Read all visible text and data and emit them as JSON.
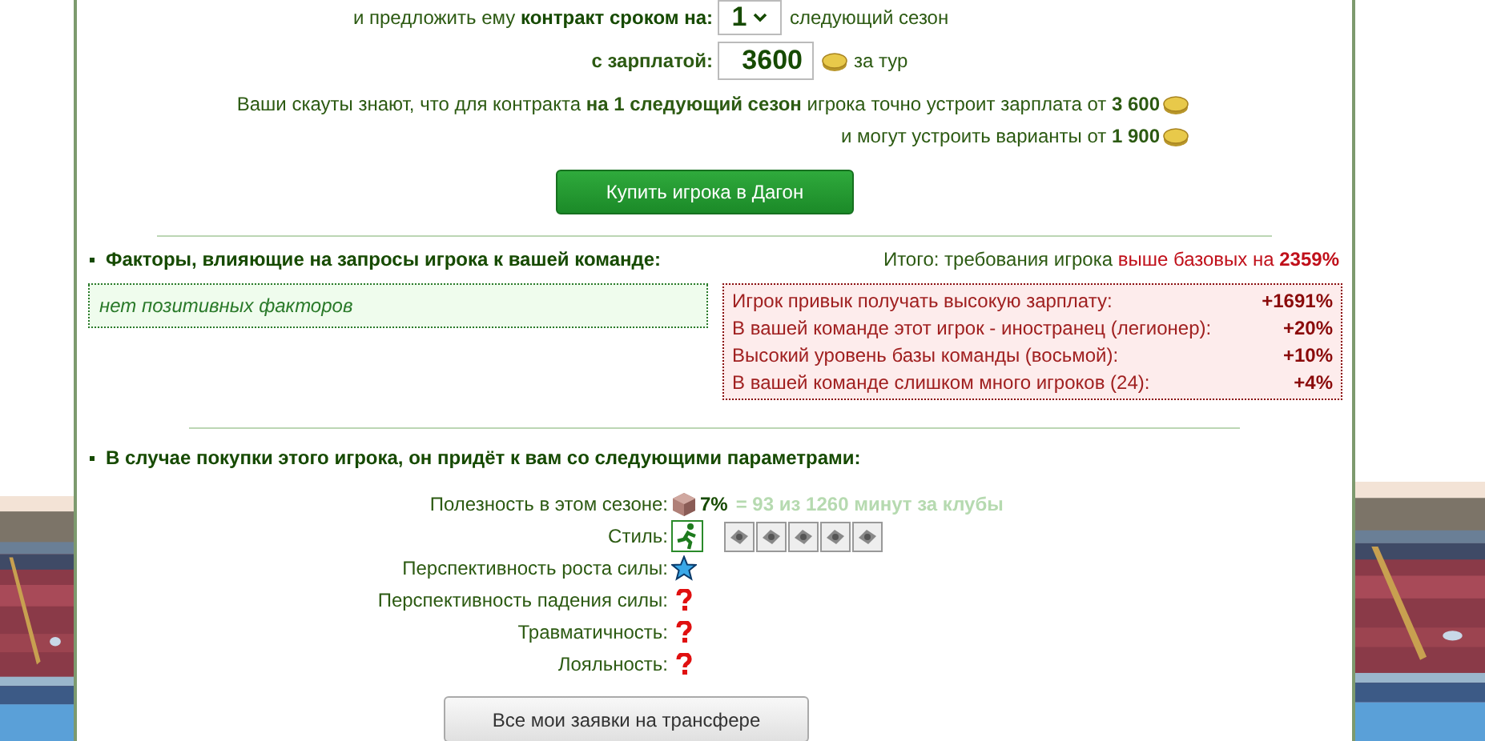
{
  "contract": {
    "prefix": "и предложить ему ",
    "prefix_bold": "контракт сроком на:",
    "term": "1",
    "term_suffix": "следующий сезон"
  },
  "salary": {
    "label": "с зарплатой:",
    "value": "3600",
    "suffix": "за тур"
  },
  "scouts": {
    "line1": "Ваши скауты знают, что для контракта **на 1 следующий сезон** игрока точно устроит зарплата от **3 600**",
    "line2": "и могут устроить варианты от **1 900**"
  },
  "buy_button": "Купить игрока в Дагон",
  "factors": {
    "title": "Факторы, влияющие на запросы игрока к вашей команде:",
    "total_prefix": "Итого: требования игрока ",
    "total_dir": "выше базовых на ",
    "total_value": "2359%",
    "positive": [
      "нет позитивных факторов"
    ],
    "negative": [
      {
        "label": "Игрок привык получать высокую зарплату:",
        "value": "+1691%"
      },
      {
        "label": "В вашей команде этот игрок - иностранец (легионер):",
        "value": "+20%"
      },
      {
        "label": "Высокий уровень базы команды (восьмой):",
        "value": "+10%"
      },
      {
        "label": "В вашей команде слишком много игроков (24):",
        "value": "+4%"
      }
    ]
  },
  "params": {
    "title": "В случае покупки этого игрока, он придёт к вам со следующими параметрами:",
    "rows": [
      {
        "kind": "usefulness",
        "label": "Полезность в этом сезоне:",
        "value": "7%",
        "detail": "= 93 из 1260 минут за клубы"
      },
      {
        "kind": "style",
        "label": "Стиль:",
        "styles": [
          {
            "selected": true
          },
          {
            "selected": false
          },
          {
            "selected": false
          },
          {
            "selected": false
          },
          {
            "selected": false
          },
          {
            "selected": false
          }
        ]
      },
      {
        "kind": "star",
        "label": "Перспективность роста силы:"
      },
      {
        "kind": "unknown",
        "label": "Перспективность падения силы:"
      },
      {
        "kind": "unknown",
        "label": "Травматичность:"
      },
      {
        "kind": "unknown",
        "label": "Лояльность:"
      }
    ]
  },
  "transfers_button": "Все мои заявки на трансфере"
}
